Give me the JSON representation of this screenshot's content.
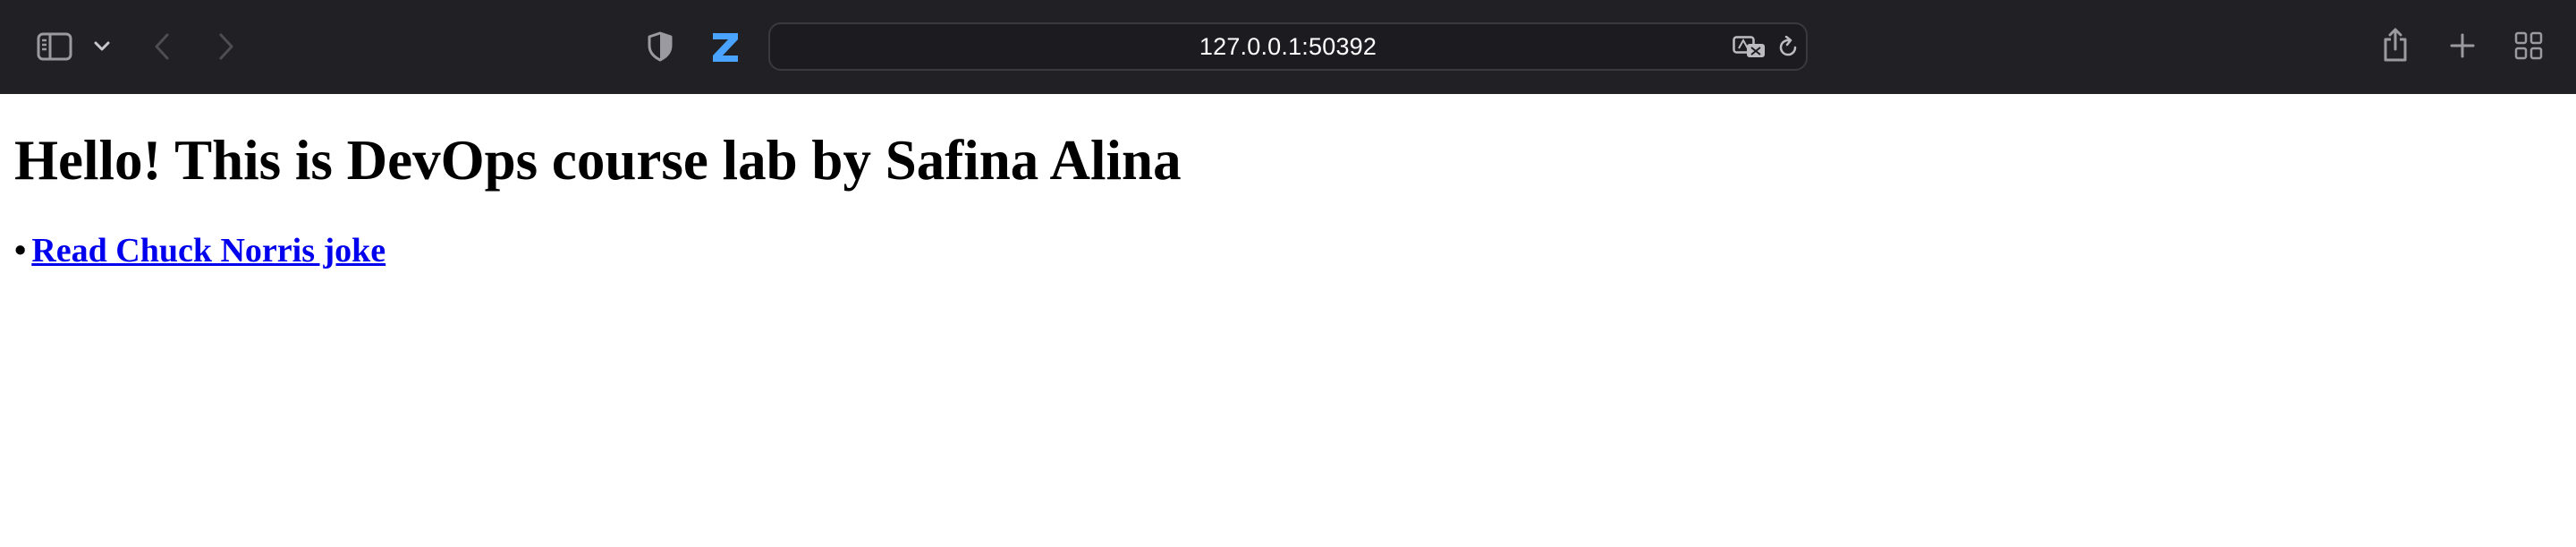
{
  "browser": {
    "address_bar": {
      "url": "127.0.0.1:50392"
    },
    "icons": {
      "sidebar": "sidebar-icon",
      "sidebar_menu": "chevron-down-icon",
      "back": "chevron-left-icon",
      "forward": "chevron-right-icon",
      "privacy": "shield-icon",
      "extension": "z-extension-icon",
      "translate": "translate-icon",
      "reload": "reload-icon",
      "share": "share-icon",
      "new_tab": "plus-icon",
      "tab_overview": "grid-icon"
    },
    "colors": {
      "toolbar": "#212025",
      "extension_blue": "#4aa3ff",
      "link": "#0000ee"
    }
  },
  "page": {
    "heading": "Hello! This is DevOps course lab by Safina Alina",
    "list": {
      "bullet": "•",
      "items": [
        {
          "label": "Read Chuck Norris joke"
        }
      ]
    }
  }
}
